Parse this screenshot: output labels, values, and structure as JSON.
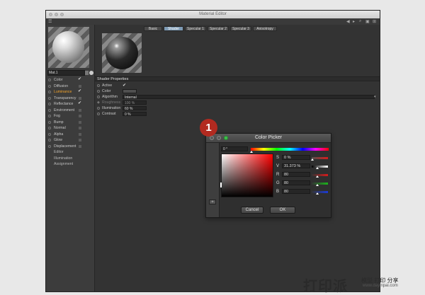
{
  "window": {
    "title": "Material Editor",
    "toolbar_left_icon": "menu-icon",
    "toolbar_right_icons": [
      "back-arrow-icon",
      "forward-arrow-icon",
      "search-icon",
      "lock-icon",
      "settings-icon"
    ]
  },
  "material": {
    "name": "Mat.1",
    "channels": [
      {
        "label": "Color",
        "checked": true,
        "active": false
      },
      {
        "label": "Diffusion",
        "checked": false,
        "active": false
      },
      {
        "label": "Luminance",
        "checked": true,
        "active": true
      },
      {
        "label": "Transparency",
        "checked": false,
        "active": false
      },
      {
        "label": "Reflectance",
        "checked": true,
        "active": false
      },
      {
        "label": "Environment",
        "checked": false,
        "active": false
      },
      {
        "label": "Fog",
        "checked": false,
        "active": false
      },
      {
        "label": "Bump",
        "checked": false,
        "active": false
      },
      {
        "label": "Normal",
        "checked": false,
        "active": false
      },
      {
        "label": "Alpha",
        "checked": false,
        "active": false
      },
      {
        "label": "Glow",
        "checked": false,
        "active": false
      },
      {
        "label": "Displacement",
        "checked": false,
        "active": false
      }
    ],
    "sub_items": [
      "Editor",
      "Illumination",
      "Assignment"
    ]
  },
  "tabs": [
    "Basic",
    "Shader",
    "Specular 1",
    "Specular 2",
    "Specular 3",
    "Anisotropy"
  ],
  "selected_tab": "Shader",
  "shader": {
    "header": "Shader Properties",
    "active_label": "Active",
    "active_checked": "✔",
    "color_label": "Color",
    "algorithm_label": "Algorithm",
    "algorithm_value": "Internal",
    "roughness_label": "Roughness",
    "roughness_value": "100 %",
    "illumination_label": "Illumination",
    "illumination_value": "60 %",
    "contrast_label": "Contrast",
    "contrast_value": "0 %"
  },
  "picker": {
    "badge": "1",
    "title": "Color Picker",
    "hue_value": "0 °",
    "rows": [
      {
        "label": "S",
        "value": "0 %"
      },
      {
        "label": "V",
        "value": "31.373 %"
      },
      {
        "label": "R",
        "value": "80"
      },
      {
        "label": "G",
        "value": "80"
      },
      {
        "label": "B",
        "value": "80"
      }
    ],
    "add_label": "+",
    "cancel_label": "Cancel",
    "ok_label": "OK",
    "colors": {
      "red": "#d81b1b",
      "green": "#1bb51b",
      "blue": "#1b3bd8"
    }
  },
  "watermark": {
    "big": "打印派",
    "top": "模型 打印 分享",
    "bottom": "www.dayinpai.com"
  }
}
